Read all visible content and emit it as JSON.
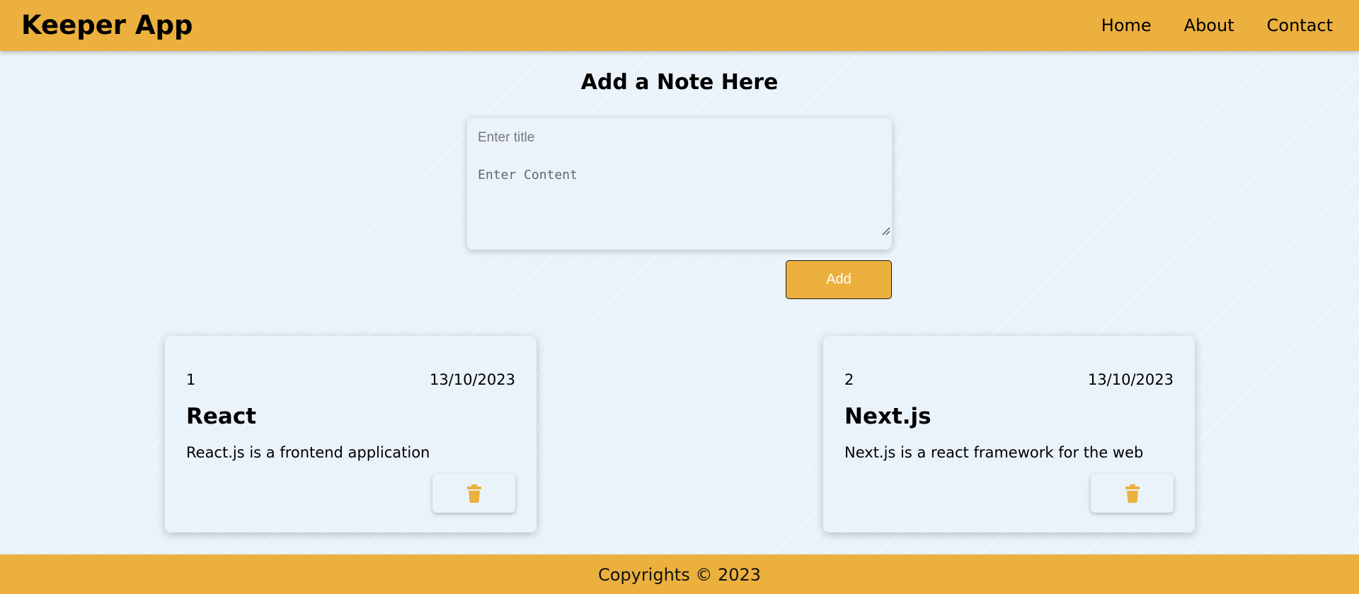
{
  "header": {
    "brand": "Keeper App",
    "nav": [
      "Home",
      "About",
      "Contact"
    ]
  },
  "form": {
    "heading": "Add a Note Here",
    "title_placeholder": "Enter title",
    "content_placeholder": "Enter Content",
    "add_label": "Add"
  },
  "notes": [
    {
      "id": "1",
      "date": "13/10/2023",
      "title": "React",
      "content": "React.js is a frontend application"
    },
    {
      "id": "2",
      "date": "13/10/2023",
      "title": "Next.js",
      "content": "Next.js is a react framework for the web"
    }
  ],
  "footer": {
    "text": "Copyrights © 2023"
  },
  "icons": {
    "delete": "trash-icon",
    "resize": "resize-grip-icon"
  },
  "colors": {
    "accent": "#ebb03e",
    "background": "#eaf2fa"
  }
}
